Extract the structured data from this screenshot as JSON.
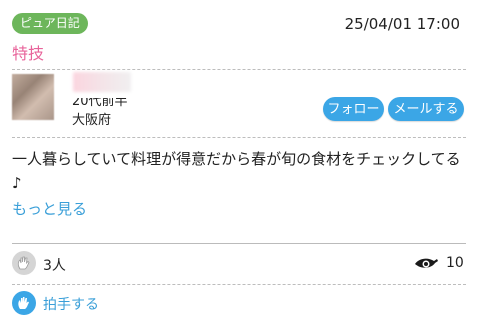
{
  "post": {
    "badge": "ピュア日記",
    "datetime": "25/04/01 17:00",
    "title": "特技"
  },
  "profile": {
    "age_line": "20代前半",
    "area": "大阪府"
  },
  "actions": {
    "follow_label": "フォロー",
    "mail_label": "メールする"
  },
  "content": {
    "body": "一人暮らしていて料理が得意だから春が旬の食材をチェックしてる♪",
    "more_label": "もっと見る"
  },
  "stats": {
    "clap_count": "3人",
    "view_count": "10",
    "clap_action_label": "拍手する"
  },
  "icons": {
    "clap_gray": "clap-hand-icon",
    "eye": "eye-icon",
    "clap_blue": "clap-hand-icon"
  },
  "colors": {
    "badge": "#6db65b",
    "title": "#e8639a",
    "button": "#3ba6e6",
    "link": "#3a9fd8"
  }
}
